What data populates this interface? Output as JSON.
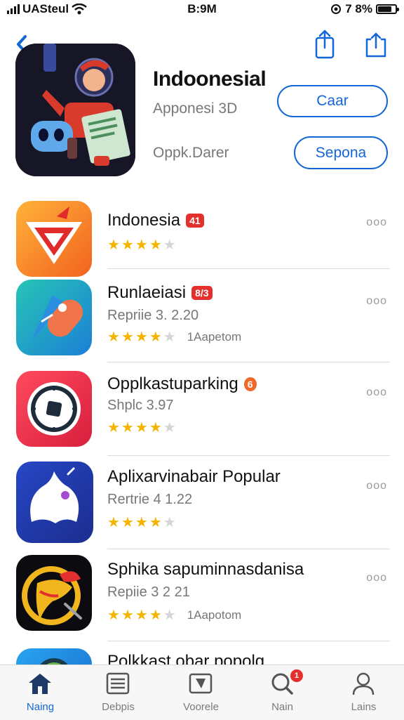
{
  "status_bar": {
    "carrier": "UASteul",
    "time": "B:9M",
    "battery": "7 8%",
    "battery_level": 0.8
  },
  "header": {
    "back_icon": "chevron-left-icon",
    "share_icon": "share-icon",
    "second_share_icon": "share-icon"
  },
  "hero": {
    "title": "Indoonesial",
    "subtitle": "Apponesi 3D",
    "developer": "Oppk.Darer",
    "get_label": "Caar",
    "open_label": "Sepona"
  },
  "apps": [
    {
      "name": "Indonesia",
      "badge": "41",
      "meta": "",
      "rating": 4.5,
      "reviews": "",
      "more": "ooo"
    },
    {
      "name": "Runlaeiasi",
      "badge": "8/3",
      "meta": "Repriie 3. 2.20",
      "rating": 4,
      "reviews": "1Aapetom",
      "more": "ooo"
    },
    {
      "name": "Opplkastuparking",
      "badge": "6",
      "meta": "Shplc 3.97",
      "rating": 4,
      "reviews": "",
      "more": "ooo"
    },
    {
      "name": "Aplixarvinabair Popular",
      "badge": "",
      "meta": "Rertrie 4 1.22",
      "rating": 4.5,
      "reviews": "",
      "more": "ooo"
    },
    {
      "name": "Sphika sapuminnasdanisa",
      "badge": "",
      "meta": "Repiie 3 2 21",
      "rating": 4.5,
      "reviews": "1Aapotom",
      "more": "ooo"
    },
    {
      "name": "Polkkast obar popolg",
      "badge": "",
      "meta": "",
      "rating": 0,
      "reviews": "",
      "more": ""
    }
  ],
  "tabs": [
    {
      "label": "Naing",
      "icon": "home-icon",
      "active": true
    },
    {
      "label": "Debpis",
      "icon": "list-icon",
      "active": false
    },
    {
      "label": "Voorele",
      "icon": "folder-icon",
      "active": false
    },
    {
      "label": "Nain",
      "icon": "search-icon",
      "active": false,
      "badge": "1"
    },
    {
      "label": "Lains",
      "icon": "person-icon",
      "active": false
    }
  ],
  "colors": {
    "accent": "#1366d6",
    "star": "#f4b400",
    "badge": "#e4302d"
  }
}
